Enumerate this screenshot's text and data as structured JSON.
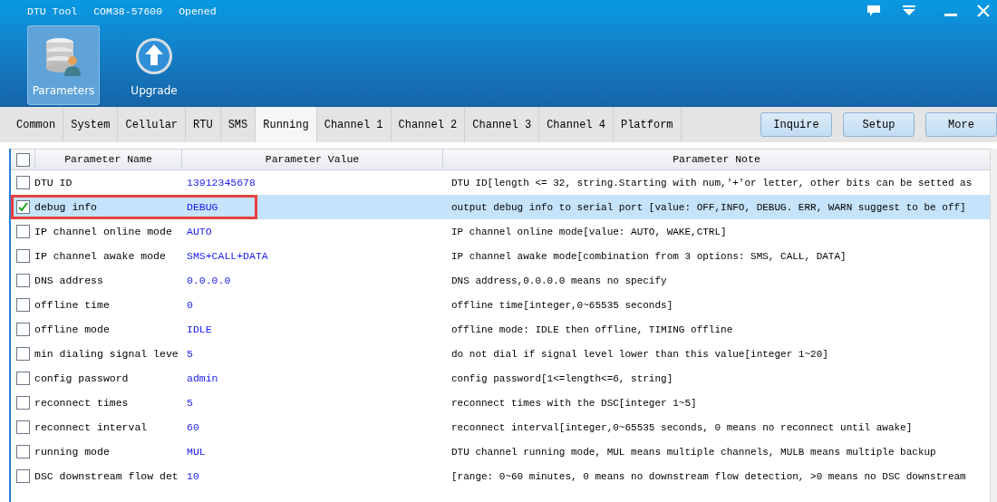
{
  "window": {
    "title": "DTU Tool",
    "port": "COM38-57600",
    "status": "Opened"
  },
  "toolbar": [
    {
      "label": "Parameters",
      "kind": "database",
      "selected": true
    },
    {
      "label": "Upgrade",
      "kind": "upload",
      "selected": false
    }
  ],
  "tabs": [
    {
      "label": "Common",
      "selected": false
    },
    {
      "label": "System",
      "selected": false
    },
    {
      "label": "Cellular",
      "selected": false
    },
    {
      "label": "RTU",
      "selected": false
    },
    {
      "label": "SMS",
      "selected": false
    },
    {
      "label": "Running",
      "selected": true
    },
    {
      "label": "Channel 1",
      "selected": false
    },
    {
      "label": "Channel 2",
      "selected": false
    },
    {
      "label": "Channel 3",
      "selected": false
    },
    {
      "label": "Channel 4",
      "selected": false
    },
    {
      "label": "Platform",
      "selected": false
    }
  ],
  "buttons": [
    "Inquire",
    "Setup",
    "More"
  ],
  "table": {
    "select_all": false,
    "columns": [
      "Parameter Name",
      "Parameter Value",
      "Parameter Note"
    ],
    "rows": [
      {
        "name": "DTU ID",
        "value": "13912345678",
        "note": "DTU ID[length <= 32, string.Starting with num,'+'or letter, other bits can be setted as",
        "checked": false,
        "selected": false,
        "outlined": false
      },
      {
        "name": "debug info",
        "value": "DEBUG",
        "note": "output debug info to serial port [value: OFF,INFO, DEBUG. ERR, WARN suggest to be off]",
        "checked": true,
        "selected": true,
        "outlined": true
      },
      {
        "name": "IP channel online mode",
        "value": "AUTO",
        "note": "IP channel online mode[value: AUTO, WAKE,CTRL]",
        "checked": false,
        "selected": false,
        "outlined": false
      },
      {
        "name": "IP channel awake mode",
        "value": "SMS+CALL+DATA",
        "note": "IP channel awake mode[combination from 3 options: SMS, CALL, DATA]",
        "checked": false,
        "selected": false,
        "outlined": false
      },
      {
        "name": "DNS address",
        "value": "0.0.0.0",
        "note": "DNS address,0.0.0.0 means no specify",
        "checked": false,
        "selected": false,
        "outlined": false
      },
      {
        "name": "offline time",
        "value": "0",
        "note": "offline time[integer,0~65535 seconds]",
        "checked": false,
        "selected": false,
        "outlined": false
      },
      {
        "name": "offline mode",
        "value": "IDLE",
        "note": "offline mode: IDLE then offline, TIMING offline",
        "checked": false,
        "selected": false,
        "outlined": false
      },
      {
        "name": "min dialing signal leve",
        "value": "5",
        "note": "do not dial if signal level lower than this value[integer 1~20]",
        "checked": false,
        "selected": false,
        "outlined": false
      },
      {
        "name": "config password",
        "value": "admin",
        "note": "config password[1<=length<=6, string]",
        "checked": false,
        "selected": false,
        "outlined": false
      },
      {
        "name": "reconnect times",
        "value": "5",
        "note": "reconnect times with the DSC[integer 1~5]",
        "checked": false,
        "selected": false,
        "outlined": false
      },
      {
        "name": "reconnect interval",
        "value": "60",
        "note": "reconnect interval[integer,0~65535 seconds, 0 means no reconnect until awake]",
        "checked": false,
        "selected": false,
        "outlined": false
      },
      {
        "name": "running mode",
        "value": "MUL",
        "note": "DTU channel running mode, MUL means multiple channels, MULB means multiple backup",
        "checked": false,
        "selected": false,
        "outlined": false
      },
      {
        "name": "DSC downstream flow det",
        "value": "10",
        "note": "[range: 0~60 minutes, 0 means no downstream flow detection, >0 means no DSC downstream",
        "checked": false,
        "selected": false,
        "outlined": false
      }
    ]
  }
}
